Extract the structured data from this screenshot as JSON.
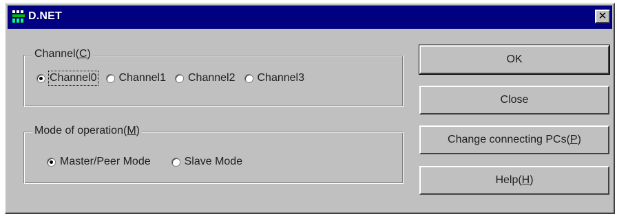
{
  "window": {
    "title": "D.NET",
    "close_glyph": "✕"
  },
  "channel_group": {
    "legend_text": "Channel(",
    "legend_key": "C",
    "legend_end": ")",
    "options": [
      {
        "label": "Channel0",
        "checked": true
      },
      {
        "label": "Channel1",
        "checked": false
      },
      {
        "label": "Channel2",
        "checked": false
      },
      {
        "label": "Channel3",
        "checked": false
      }
    ]
  },
  "mode_group": {
    "legend_text": "Mode of operation(",
    "legend_key": "M",
    "legend_end": ")",
    "options": [
      {
        "label": "Master/Peer Mode",
        "checked": true
      },
      {
        "label": "Slave Mode",
        "checked": false
      }
    ]
  },
  "buttons": {
    "ok": "OK",
    "close": "Close",
    "change_text": "Change connecting PCs(",
    "change_key": "P",
    "change_end": ")",
    "help_text": "Help(",
    "help_key": "H",
    "help_end": ")"
  },
  "colors": {
    "titlebar": "#000080",
    "face": "#c0c0c0"
  },
  "icons": {
    "app": "network-app-icon",
    "close": "close-icon"
  }
}
